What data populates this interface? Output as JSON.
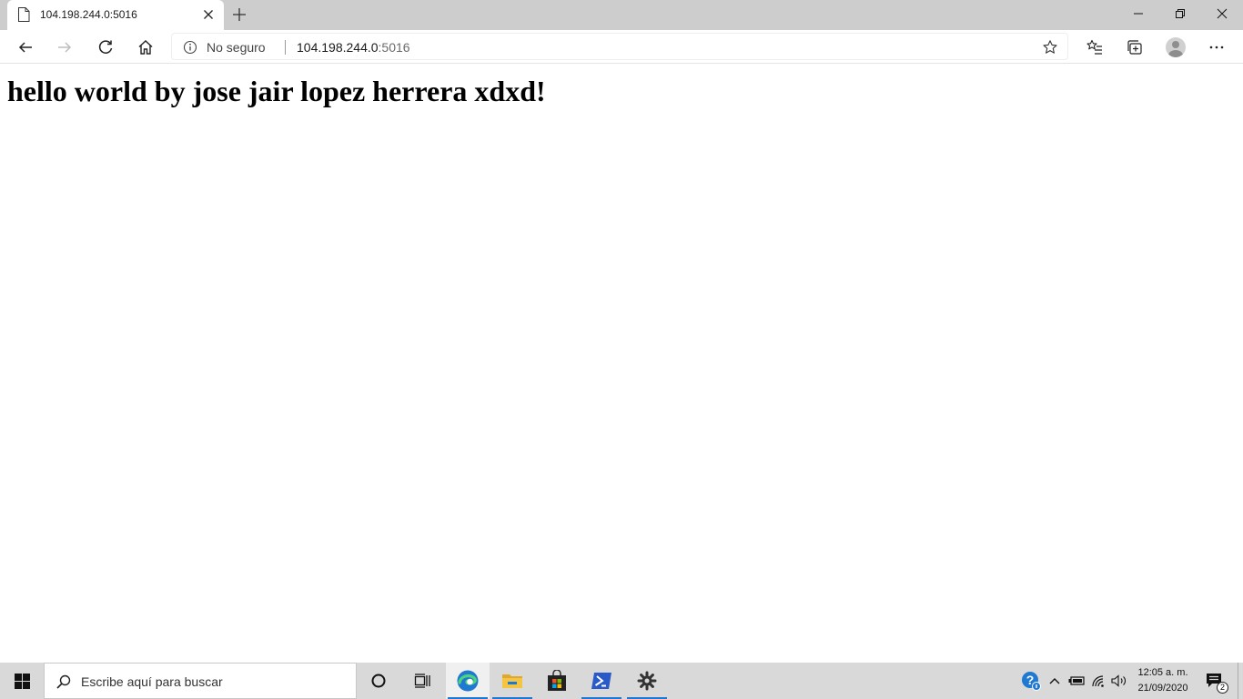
{
  "browser": {
    "tab": {
      "title": "104.198.244.0:5016"
    },
    "address_bar": {
      "security_label": "No seguro",
      "url_host": "104.198.244.0",
      "url_port": ":5016"
    }
  },
  "page": {
    "heading": "hello world by jose jair lopez herrera xdxd!"
  },
  "taskbar": {
    "search_placeholder": "Escribe aquí para buscar",
    "clock": {
      "time": "12:05 a. m.",
      "date": "21/09/2020"
    },
    "notification_count": "2",
    "apps": [
      "cortana-icon",
      "task-view-icon",
      "edge-icon",
      "file-explorer-icon",
      "store-icon",
      "powershell-icon",
      "settings-icon"
    ]
  },
  "colors": {
    "tabstrip_bg": "#cdcdcd",
    "taskbar_bg": "#d9d9d9",
    "edge_blue": "#1f78d1",
    "folder_yellow": "#f4c542",
    "powershell_blue": "#2a5ac8"
  }
}
